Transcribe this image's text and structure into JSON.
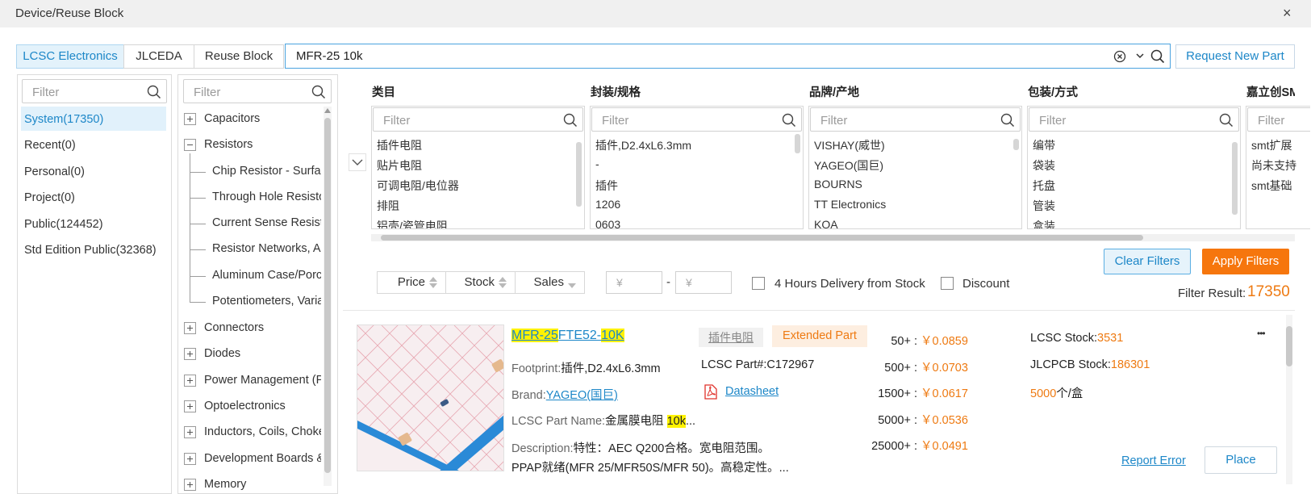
{
  "window": {
    "title": "Device/Reuse Block",
    "close_glyph": "×"
  },
  "tabs": [
    {
      "label": "LCSC Electronics",
      "active": true
    },
    {
      "label": "JLCEDA",
      "active": false
    },
    {
      "label": "Reuse Block",
      "active": false
    }
  ],
  "search": {
    "value": "MFR-25 10k",
    "request_label": "Request New Part"
  },
  "library": {
    "filter_placeholder": "Filter",
    "items": [
      {
        "label": "System(17350)",
        "selected": true
      },
      {
        "label": "Recent(0)"
      },
      {
        "label": "Personal(0)"
      },
      {
        "label": "Project(0)"
      },
      {
        "label": "Public(124452)"
      },
      {
        "label": "Std Edition Public(32368)"
      }
    ]
  },
  "category_tree": {
    "filter_placeholder": "Filter",
    "top": [
      {
        "label": "Capacitors",
        "expanded": false
      },
      {
        "label": "Resistors",
        "expanded": true
      }
    ],
    "resistor_children": [
      "Chip Resistor - Surface Mount",
      "Through Hole Resistors",
      "Current Sense Resistors",
      "Resistor Networks, Arrays",
      "Aluminum Case/Porcelain Tube Resistors",
      "Potentiometers, Variable Resistors"
    ],
    "bottom": [
      {
        "label": "Connectors"
      },
      {
        "label": "Diodes"
      },
      {
        "label": "Power Management (PMIC)"
      },
      {
        "label": "Optoelectronics"
      },
      {
        "label": "Inductors, Coils, Chokes"
      },
      {
        "label": "Development Boards & Kits"
      },
      {
        "label": "Memory"
      }
    ]
  },
  "facets": {
    "filter_placeholder": "Filter",
    "columns": [
      {
        "title": "类目",
        "options": [
          "插件电阻",
          "贴片电阻",
          "可调电阻/电位器",
          "排阻",
          "铝壳/瓷管电阻"
        ]
      },
      {
        "title": "封装/规格",
        "options": [
          "插件,D2.4xL6.3mm",
          "-",
          "插件",
          "1206",
          "0603"
        ]
      },
      {
        "title": "品牌/产地",
        "options": [
          "VISHAY(威世)",
          "YAGEO(国巨)",
          "BOURNS",
          "TT Electronics",
          "KOA"
        ]
      },
      {
        "title": "包装/方式",
        "options": [
          "编带",
          "袋装",
          "托盘",
          "管装",
          "盒装"
        ]
      },
      {
        "title": "嘉立创SMT",
        "options": [
          "smt扩展",
          "尚未支持",
          "smt基础"
        ]
      }
    ]
  },
  "actions": {
    "clear_label": "Clear Filters",
    "apply_label": "Apply Filters"
  },
  "sort": {
    "price": "Price",
    "stock": "Stock",
    "sales": "Sales",
    "currency_symbol": "¥",
    "range_sep": "-",
    "delivery_label": "4 Hours Delivery from Stock",
    "discount_label": "Discount"
  },
  "result": {
    "label": "Filter Result:",
    "count": "17350"
  },
  "part": {
    "name_hl1": "MFR-25",
    "name_mid": "FTE52-",
    "name_hl2": "10K",
    "category_tag": "插件电阻",
    "type_tag": "Extended Part",
    "footprint_label": "Footprint:",
    "footprint_value": "插件,D2.4xL6.3mm",
    "lcsc_part_label": "LCSC Part#:",
    "lcsc_part_value": "C172967",
    "brand_label": "Brand:",
    "brand_value": "YAGEO(国巨)",
    "datasheet_label": "Datasheet",
    "lcsc_name_label": "LCSC Part Name:",
    "lcsc_name_value": "金属膜电阻",
    "lcsc_name_hl": "10k",
    "lcsc_name_ellipsis": "...",
    "desc_label": "Description:",
    "desc_line1": "特性：AEC Q200合格。宽电阻范围。",
    "desc_line2": "PPAP就绪(MFR 25/MFR50S/MFR 50)。高稳定性。...",
    "price_breaks": [
      {
        "qty": "50+ :",
        "price": "￥0.0859"
      },
      {
        "qty": "500+ :",
        "price": "￥0.0703"
      },
      {
        "qty": "1500+ :",
        "price": "￥0.0617"
      },
      {
        "qty": "5000+ :",
        "price": "￥0.0536"
      },
      {
        "qty": "25000+ :",
        "price": "￥0.0491"
      }
    ],
    "lcsc_stock_label": "LCSC Stock:",
    "lcsc_stock_value": "3531",
    "jlcpcb_stock_label": "JLCPCB Stock:",
    "jlcpcb_stock_value": "186301",
    "pack_qty": "5000",
    "pack_unit": "个/盒",
    "more_glyph": "•••",
    "report_label": "Report Error",
    "place_label": "Place"
  },
  "colors": {
    "accent": "#1d87c8",
    "orange": "#f6760d",
    "highlight": "#fff200"
  }
}
